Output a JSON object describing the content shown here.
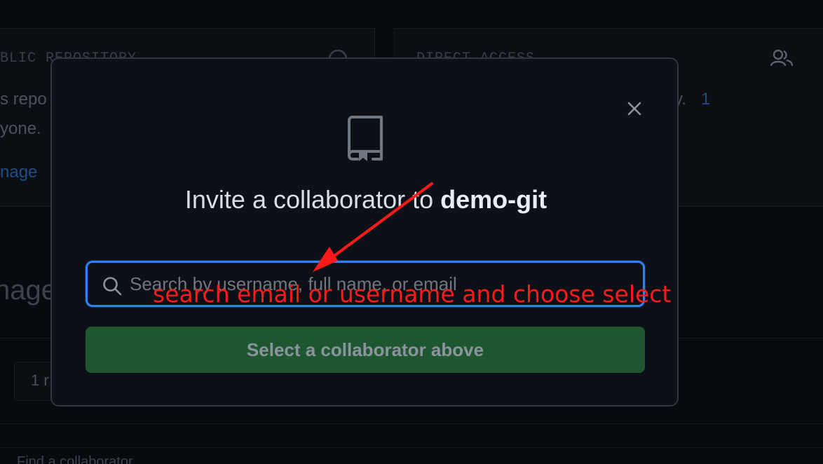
{
  "background": {
    "left_card": {
      "section_label": "BLIC REPOSITORY",
      "line1": "s repo",
      "line2": "yone.",
      "link": "nage"
    },
    "right_card": {
      "section_label": "DIRECT ACCESS",
      "line1": "ry.",
      "count": "1"
    },
    "section_heading": "nage",
    "pill_text": "1 r",
    "bottom_text": "Find a collaborator"
  },
  "modal": {
    "title_prefix": "Invite a collaborator to ",
    "repo_name": "demo-git",
    "search": {
      "placeholder": "Search by username, full name, or email",
      "value": ""
    },
    "select_button_label": "Select a collaborator above"
  },
  "annotation": {
    "text": "search email or username and choose select",
    "color": "#ff1a1a"
  },
  "colors": {
    "modal_bg": "#0d1117",
    "focus_border": "#2f81f7",
    "button_bg": "#1e5630"
  }
}
